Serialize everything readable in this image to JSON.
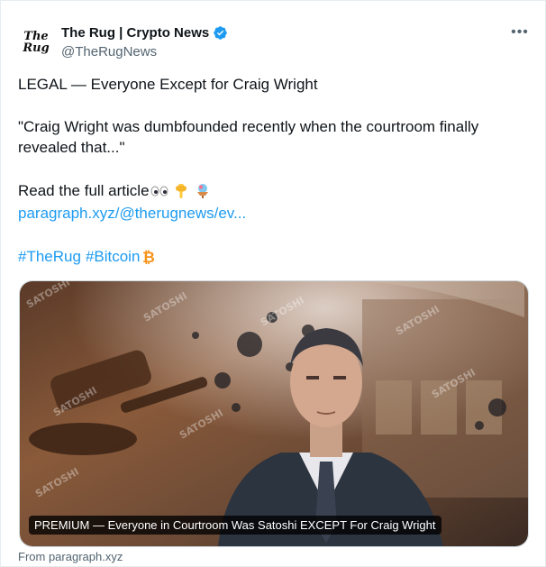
{
  "author": {
    "display_name": "The Rug | Crypto News",
    "handle": "@TheRugNews",
    "avatar_line1": "The",
    "avatar_line2": "Rug"
  },
  "more_label": "•••",
  "tweet": {
    "line1": "LEGAL — Everyone Except for Craig Wright",
    "line2": "\"Craig Wright was dumbfounded recently when the courtroom finally revealed that...\"",
    "line3": "Read the full article",
    "link": "paragraph.xyz/@therugnews/ev...",
    "hashtags": [
      "#TheRug",
      "#Bitcoin"
    ]
  },
  "media": {
    "caption": "PREMIUM — Everyone in Courtroom Was Satoshi EXCEPT For Craig Wright",
    "watermark": "SATOSHI"
  },
  "from": "From paragraph.xyz",
  "colors": {
    "link": "#1d9bf0",
    "verified": "#1d9bf0",
    "bitcoin": "#f7931a"
  }
}
